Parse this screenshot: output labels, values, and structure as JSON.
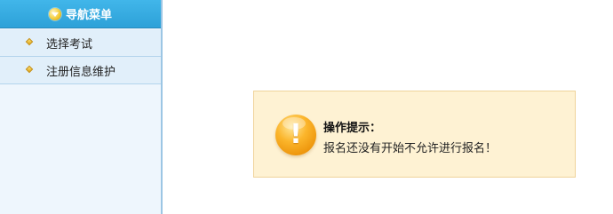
{
  "sidebar": {
    "header": {
      "title": "导航菜单",
      "icon": "chevron-down-icon"
    },
    "items": [
      {
        "label": "选择考试",
        "icon": "diamond-bullet-icon"
      },
      {
        "label": "注册信息维护",
        "icon": "diamond-bullet-icon"
      }
    ]
  },
  "alert": {
    "title": "操作提示：",
    "message": "报名还没有开始不允许进行报名！",
    "icon": "exclamation-icon",
    "icon_glyph": "!",
    "background_color": "#fef2d3",
    "border_color": "#efd39a"
  },
  "colors": {
    "nav_header": "#2da1d8",
    "sidebar_bg": "#eef6fd",
    "sidebar_border": "#9cc6e4"
  }
}
